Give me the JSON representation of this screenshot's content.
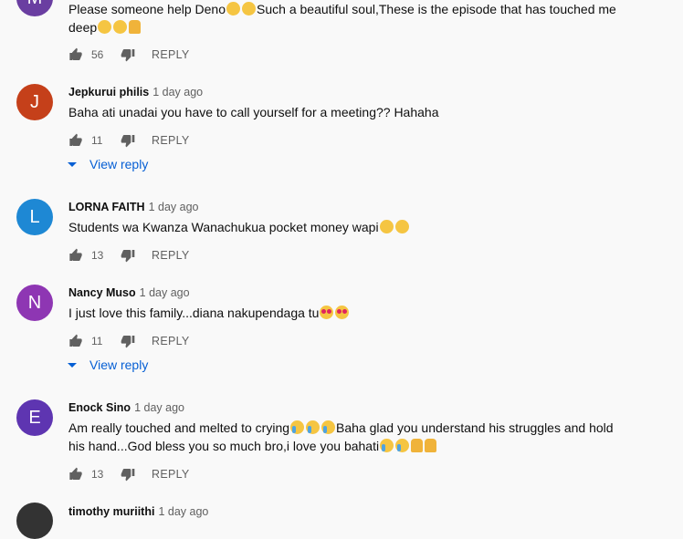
{
  "comments": [
    {
      "avatar_letter": "M",
      "avatar_color": "#6a3ea1",
      "author": "",
      "time": "",
      "text_line1": "Please someone help Deno",
      "text_mid": "Such a beautiful soul,These is the episode that has touched me",
      "text_line2": "deep",
      "likes": "56",
      "reply_label": "REPLY"
    },
    {
      "avatar_letter": "J",
      "avatar_color": "#c5401a",
      "author": "Jepkurui philis",
      "time": "1 day ago",
      "text": "Baha ati unadai you have to call yourself for a meeting?? Hahaha",
      "likes": "11",
      "reply_label": "REPLY",
      "view_reply": "View reply"
    },
    {
      "avatar_letter": "L",
      "avatar_color": "#1e88d4",
      "author": "LORNA FAITH",
      "time": "1 day ago",
      "text": "Students wa Kwanza Wanachukua pocket money wapi",
      "likes": "13",
      "reply_label": "REPLY"
    },
    {
      "avatar_letter": "N",
      "avatar_color": "#8e36b3",
      "author": "Nancy Muso",
      "time": "1 day ago",
      "text": "I just love this family...diana nakupendaga tu",
      "likes": "11",
      "reply_label": "REPLY",
      "view_reply": "View reply"
    },
    {
      "avatar_letter": "E",
      "avatar_color": "#5e35b1",
      "author": "Enock Sino",
      "time": "1 day ago",
      "text_line1": "Am really touched and melted to crying",
      "text_line1b": "Baha glad you understand his struggles and hold",
      "text_line2": "his hand...God bless you so much bro,i love you bahati",
      "likes": "13",
      "reply_label": "REPLY"
    },
    {
      "avatar_letter": "",
      "avatar_color": "#333333",
      "author": "timothy muriithi",
      "time": "1 day ago"
    }
  ],
  "icons": {
    "like": "thumb-up-icon",
    "dislike": "thumb-down-icon",
    "view_reply_caret": "caret-down-icon"
  }
}
